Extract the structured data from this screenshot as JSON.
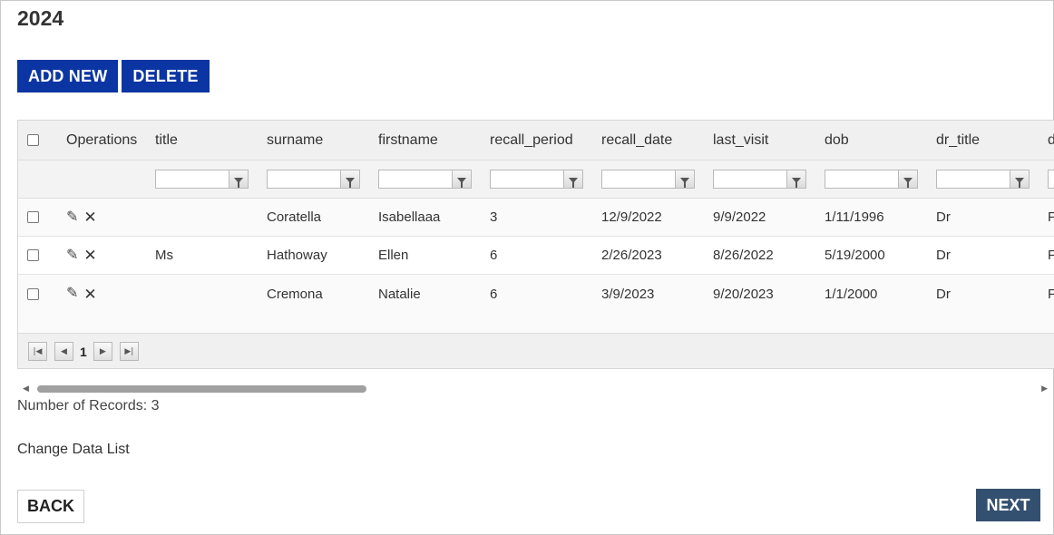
{
  "page": {
    "title": "2024"
  },
  "toolbar": {
    "add_label": "ADD NEW",
    "delete_label": "DELETE"
  },
  "grid": {
    "ops_header": "Operations",
    "columns": [
      "title",
      "surname",
      "firstname",
      "recall_period",
      "recall_date",
      "last_visit",
      "dob",
      "dr_title",
      "d"
    ],
    "rows": [
      {
        "title": "",
        "surname": "Coratella",
        "firstname": "Isabellaaa",
        "recall_period": "3",
        "recall_date": "12/9/2022",
        "last_visit": "9/9/2022",
        "dob": "1/11/1996",
        "dr_title": "Dr",
        "extra": "F"
      },
      {
        "title": "Ms",
        "surname": "Hathoway",
        "firstname": "Ellen",
        "recall_period": "6",
        "recall_date": "2/26/2023",
        "last_visit": "8/26/2022",
        "dob": "5/19/2000",
        "dr_title": "Dr",
        "extra": "F"
      },
      {
        "title": "",
        "surname": "Cremona",
        "firstname": "Natalie",
        "recall_period": "6",
        "recall_date": "3/9/2023",
        "last_visit": "9/20/2023",
        "dob": "1/1/2000",
        "dr_title": "Dr",
        "extra": "F"
      }
    ],
    "pager": {
      "page": "1",
      "first_icon": "first-page-icon",
      "prev_icon": "prev-page-icon",
      "next_icon": "next-page-icon",
      "last_icon": "last-page-icon"
    }
  },
  "footer": {
    "records_text": "Number of Records: 3",
    "change_list": "Change Data List",
    "back_label": "BACK",
    "next_label": "NEXT"
  },
  "colors": {
    "primary": "#0b35a3",
    "next_button": "#345070"
  }
}
